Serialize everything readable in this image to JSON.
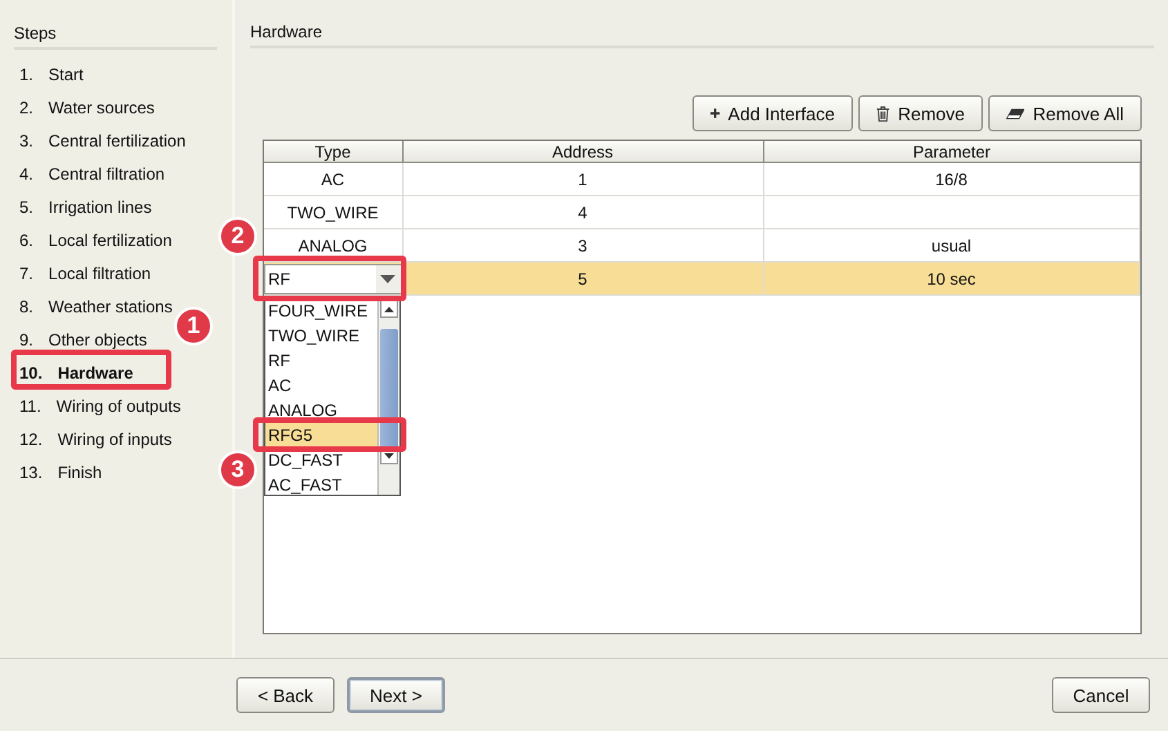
{
  "steps_panel": {
    "title": "Steps",
    "items": [
      {
        "number": "1.",
        "label": "Start",
        "selected": false
      },
      {
        "number": "2.",
        "label": "Water sources",
        "selected": false
      },
      {
        "number": "3.",
        "label": "Central fertilization",
        "selected": false
      },
      {
        "number": "4.",
        "label": "Central filtration",
        "selected": false
      },
      {
        "number": "5.",
        "label": "Irrigation lines",
        "selected": false
      },
      {
        "number": "6.",
        "label": "Local fertilization",
        "selected": false
      },
      {
        "number": "7.",
        "label": "Local filtration",
        "selected": false
      },
      {
        "number": "8.",
        "label": "Weather stations",
        "selected": false
      },
      {
        "number": "9.",
        "label": "Other objects",
        "selected": false
      },
      {
        "number": "10.",
        "label": "Hardware",
        "selected": true
      },
      {
        "number": "11.",
        "label": "Wiring of outputs",
        "selected": false
      },
      {
        "number": "12.",
        "label": "Wiring of inputs",
        "selected": false
      },
      {
        "number": "13.",
        "label": "Finish",
        "selected": false
      }
    ]
  },
  "content": {
    "title": "Hardware",
    "toolbar": [
      {
        "label": "Add Interface"
      },
      {
        "label": "Remove"
      },
      {
        "label": "Remove All"
      }
    ],
    "table": {
      "columns": [
        "Type",
        "Address",
        "Parameter"
      ],
      "rows": [
        {
          "type": "AC",
          "address": "1",
          "parameter": "16/8",
          "selected": false,
          "editing": false
        },
        {
          "type": "TWO_WIRE",
          "address": "4",
          "selected": false,
          "editing": false
        },
        {
          "type": "ANALOG",
          "address": "3",
          "parameter": "usual",
          "selected": false,
          "editing": false
        },
        {
          "type": "RF",
          "address": "5",
          "parameter": "10 sec",
          "selected": true,
          "editing": true
        }
      ]
    },
    "type_dropdown": {
      "options": [
        {
          "label": "FOUR_WIRE",
          "selected": false
        },
        {
          "label": "TWO_WIRE",
          "selected": false
        },
        {
          "label": "RF",
          "selected": false
        },
        {
          "label": "AC",
          "selected": false
        },
        {
          "label": "ANALOG",
          "selected": false
        },
        {
          "label": "RFG5",
          "selected": true
        },
        {
          "label": "DC_FAST",
          "selected": false
        },
        {
          "label": "AC_FAST",
          "selected": false
        }
      ]
    }
  },
  "buttons": [
    {
      "label": "< Back",
      "default": false
    },
    {
      "label": "Next >",
      "default": true
    },
    {
      "label": "Cancel",
      "default": false
    }
  ],
  "callouts": [
    {
      "number": "1"
    },
    {
      "number": "2"
    },
    {
      "number": "3"
    }
  ]
}
